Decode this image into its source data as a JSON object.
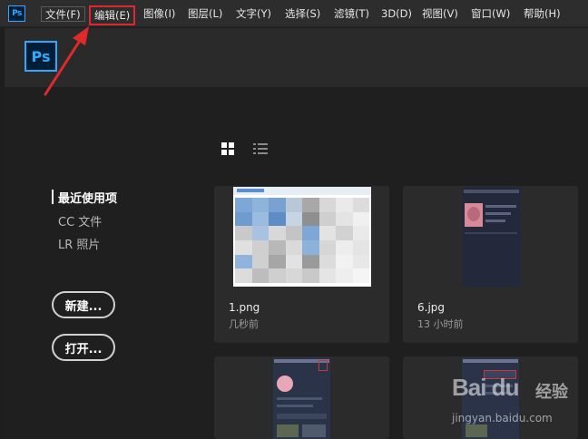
{
  "app": {
    "logo_text": "Ps",
    "brand_color": "#31a8ff"
  },
  "menubar": {
    "items": [
      {
        "label": "文件(F)"
      },
      {
        "label": "编辑(E)"
      },
      {
        "label": "图像(I)"
      },
      {
        "label": "图层(L)"
      },
      {
        "label": "文字(Y)"
      },
      {
        "label": "选择(S)"
      },
      {
        "label": "滤镜(T)"
      },
      {
        "label": "3D(D)"
      },
      {
        "label": "视图(V)"
      },
      {
        "label": "窗口(W)"
      },
      {
        "label": "帮助(H)"
      }
    ],
    "highlighted_item": "编辑(E)",
    "highlight_color": "#e0262e"
  },
  "home": {
    "view_modes": [
      "grid-view-icon",
      "list-view-icon"
    ],
    "active_view": "grid",
    "sidebar": {
      "items": [
        {
          "label": "最近使用项",
          "active": true
        },
        {
          "label": "CC 文件",
          "active": false
        },
        {
          "label": "LR 照片",
          "active": false
        }
      ],
      "new_button": "新建...",
      "open_button": "打开..."
    },
    "recent_files": [
      {
        "name": "1.png",
        "time": "几秒前"
      },
      {
        "name": "6.jpg",
        "time": "13 小时前"
      },
      {
        "name": "",
        "time": ""
      },
      {
        "name": "",
        "time": ""
      }
    ]
  },
  "watermark": {
    "logo": "Bai du",
    "cn": "经验",
    "url": "jingyan.baidu.com"
  }
}
